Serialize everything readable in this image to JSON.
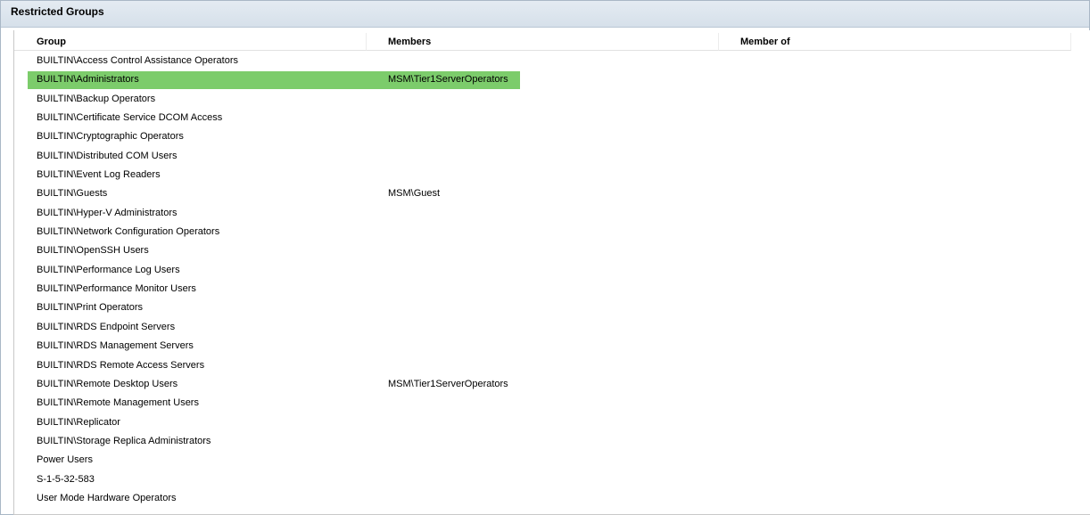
{
  "section": {
    "title": "Restricted Groups"
  },
  "table": {
    "columns": [
      "Group",
      "Members",
      "Member of"
    ],
    "rows": [
      {
        "group": "BUILTIN\\Access Control Assistance Operators",
        "members": "",
        "member_of": ""
      },
      {
        "group": "BUILTIN\\Administrators",
        "members": "MSM\\Tier1ServerOperators",
        "member_of": ""
      },
      {
        "group": "BUILTIN\\Backup Operators",
        "members": "",
        "member_of": ""
      },
      {
        "group": "BUILTIN\\Certificate Service DCOM Access",
        "members": "",
        "member_of": ""
      },
      {
        "group": "BUILTIN\\Cryptographic Operators",
        "members": "",
        "member_of": ""
      },
      {
        "group": "BUILTIN\\Distributed COM Users",
        "members": "",
        "member_of": ""
      },
      {
        "group": "BUILTIN\\Event Log Readers",
        "members": "",
        "member_of": ""
      },
      {
        "group": "BUILTIN\\Guests",
        "members": "MSM\\Guest",
        "member_of": ""
      },
      {
        "group": "BUILTIN\\Hyper-V Administrators",
        "members": "",
        "member_of": ""
      },
      {
        "group": "BUILTIN\\Network Configuration Operators",
        "members": "",
        "member_of": ""
      },
      {
        "group": "BUILTIN\\OpenSSH Users",
        "members": "",
        "member_of": ""
      },
      {
        "group": "BUILTIN\\Performance Log Users",
        "members": "",
        "member_of": ""
      },
      {
        "group": "BUILTIN\\Performance Monitor Users",
        "members": "",
        "member_of": ""
      },
      {
        "group": "BUILTIN\\Print Operators",
        "members": "",
        "member_of": ""
      },
      {
        "group": "BUILTIN\\RDS Endpoint Servers",
        "members": "",
        "member_of": ""
      },
      {
        "group": "BUILTIN\\RDS Management Servers",
        "members": "",
        "member_of": ""
      },
      {
        "group": "BUILTIN\\RDS Remote Access Servers",
        "members": "",
        "member_of": ""
      },
      {
        "group": "BUILTIN\\Remote Desktop Users",
        "members": "MSM\\Tier1ServerOperators",
        "member_of": ""
      },
      {
        "group": "BUILTIN\\Remote Management Users",
        "members": "",
        "member_of": ""
      },
      {
        "group": "BUILTIN\\Replicator",
        "members": "",
        "member_of": ""
      },
      {
        "group": "BUILTIN\\Storage Replica Administrators",
        "members": "",
        "member_of": ""
      },
      {
        "group": "Power Users",
        "members": "",
        "member_of": ""
      },
      {
        "group": "S-1-5-32-583",
        "members": "",
        "member_of": ""
      },
      {
        "group": "User Mode Hardware Operators",
        "members": "",
        "member_of": ""
      }
    ],
    "selected_row": 1,
    "highlight_color": "#7ccc6b"
  }
}
